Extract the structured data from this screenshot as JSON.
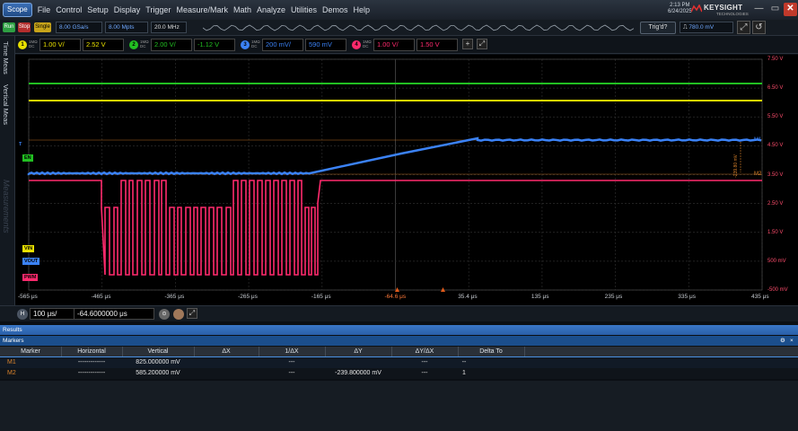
{
  "menubar": {
    "scope_label": "Scope",
    "items": [
      "File",
      "Control",
      "Setup",
      "Display",
      "Trigger",
      "Measure/Mark",
      "Math",
      "Analyze",
      "Utilities",
      "Demos",
      "Help"
    ],
    "time": "2:13 PM",
    "date": "6/24/2025",
    "brand": "KEYSIGHT",
    "brand_sub": "TECHNOLOGIES"
  },
  "toolbar": {
    "run": "Run",
    "stop": "Stop",
    "single": "Single",
    "sample_rate": "8.00 GSa/s",
    "memory_depth": "8.00 Mpts",
    "bandwidth": "20.0 MHz",
    "trig_status": "Trig'd?",
    "trigger_level": "780.0 mV"
  },
  "channels": [
    {
      "num": "1",
      "coupling": "1MΩ DC",
      "scale": "1.00 V/",
      "offset": "2.52 V",
      "color": "#e8e000"
    },
    {
      "num": "2",
      "coupling": "1MΩ DC",
      "scale": "2.00 V/",
      "offset": "-1.12 V",
      "color": "#22c022"
    },
    {
      "num": "3",
      "coupling": "1MΩ DC",
      "scale": "200 mV/",
      "offset": "590 mV",
      "color": "#3b82f6"
    },
    {
      "num": "4",
      "coupling": "1MΩ DC",
      "scale": "1.00 V/",
      "offset": "1.50 V",
      "color": "#ff2a6d"
    }
  ],
  "left_tabs": {
    "time_meas": "Time Meas",
    "vertical_meas": "Vertical Meas",
    "measurements": "Measurements"
  },
  "plot": {
    "y_labels": [
      "7.50 V",
      "6.50 V",
      "5.50 V",
      "4.50 V",
      "3.50 V",
      "2.50 V",
      "1.50 V",
      "500 mV",
      "-500 mV"
    ],
    "x_labels": [
      "-565 μs",
      "-465 μs",
      "-365 μs",
      "-265 μs",
      "-165 μs",
      "-64.6 μs",
      "35.4 μs",
      "135 μs",
      "235 μs",
      "335 μs",
      "435 μs"
    ],
    "markers": {
      "m1": "M1",
      "m2": "M2",
      "delta": "-239.80 mV"
    },
    "trace_tags": {
      "en": "EN",
      "vin": "VIN",
      "vout": "VOUT",
      "trig": "T",
      "pwm": "PWM"
    },
    "colors": {
      "ch1": "#e8e000",
      "ch2": "#22c022",
      "ch3": "#3b82f6",
      "ch4": "#ff2a6d",
      "marker": "#d9822b"
    }
  },
  "timebase": {
    "label": "H",
    "scale": "100 μs/",
    "position": "-64.6000000 μs"
  },
  "results": {
    "title": "Results",
    "panel": "Markers",
    "columns": [
      "Marker",
      "Horizontal",
      "Vertical",
      "ΔX",
      "1/ΔX",
      "ΔY",
      "ΔY/ΔX",
      "Delta To"
    ],
    "rows": [
      {
        "marker": "M1",
        "horizontal": "-------------",
        "vertical": "825.000000 mV",
        "dx": "",
        "inv_dx": "---",
        "dy": "",
        "dydx": "---",
        "delta_to": "--"
      },
      {
        "marker": "M2",
        "horizontal": "-------------",
        "vertical": "585.200000 mV",
        "dx": "",
        "inv_dx": "---",
        "dy": "-239.800000 mV",
        "dydx": "---",
        "delta_to": "1"
      }
    ]
  }
}
